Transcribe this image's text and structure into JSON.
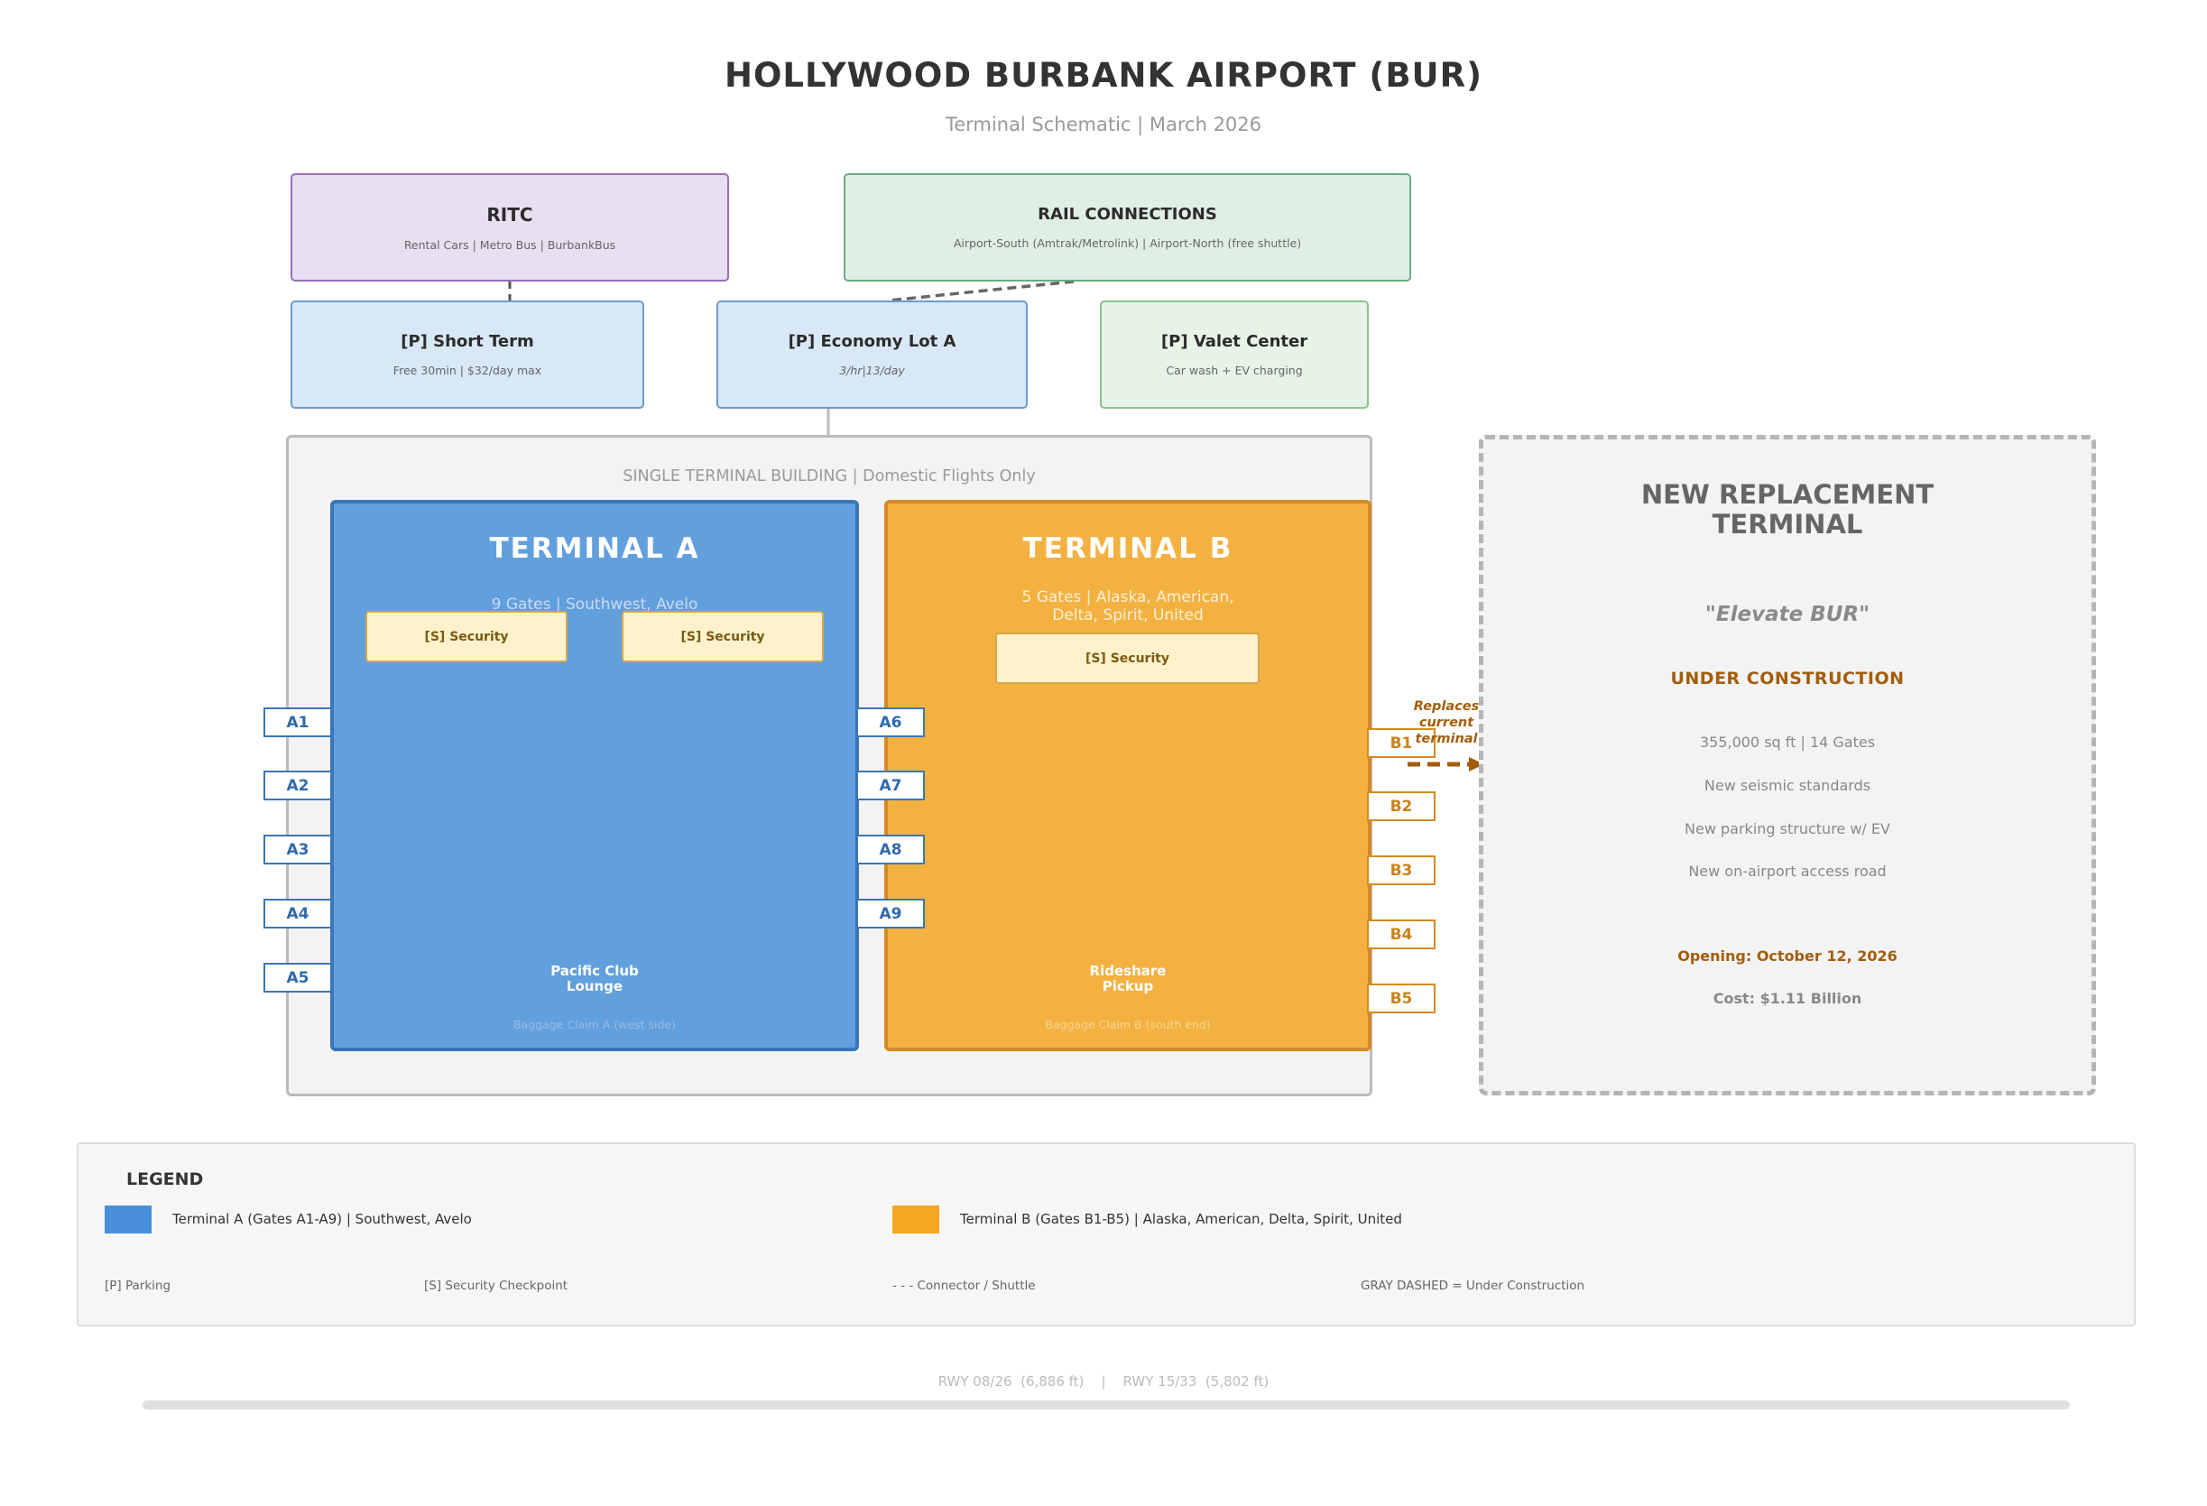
{
  "header": {
    "title": "HOLLYWOOD BURBANK AIRPORT  (BUR)",
    "subtitle": "Terminal Schematic  |  March 2026"
  },
  "top_boxes": {
    "ritc": {
      "title": "RITC",
      "subtitle": "Rental Cars  |  Metro Bus  |  BurbankBus"
    },
    "rail": {
      "title": "RAIL CONNECTIONS",
      "subtitle": "Airport-South (Amtrak/Metrolink)  |  Airport-North (free shuttle)"
    }
  },
  "parking": {
    "short_term": {
      "title": "[P]  Short Term",
      "subtitle": "Free 30min  |  $32/day max"
    },
    "economy": {
      "title": "[P]  Economy Lot A",
      "subtitle": "3/hr|13/day"
    },
    "valet": {
      "title": "[P]  Valet Center",
      "subtitle": "Car wash + EV charging"
    }
  },
  "building": {
    "label": "SINGLE TERMINAL BUILDING  |  Domestic Flights Only"
  },
  "terminal_a": {
    "title": "TERMINAL  A",
    "subtitle": "9 Gates  |  Southwest, Avelo",
    "security": [
      "[S] Security",
      "[S] Security"
    ],
    "amenity": "Pacific Club\nLounge",
    "baggage": "Baggage Claim A (west side)",
    "gates": [
      "A1",
      "A2",
      "A3",
      "A4",
      "A5",
      "A6",
      "A7",
      "A8",
      "A9"
    ]
  },
  "terminal_b": {
    "title": "TERMINAL  B",
    "subtitle": "5 Gates  |  Alaska, American,\nDelta, Spirit, United",
    "security": "[S] Security",
    "amenity": "Rideshare\nPickup",
    "baggage": "Baggage Claim B (south end)",
    "gates": [
      "B1",
      "B2",
      "B3",
      "B4",
      "B5"
    ]
  },
  "replaces_note": "Replaces\ncurrent\nterminal",
  "new_terminal": {
    "title": "NEW REPLACEMENT\nTERMINAL",
    "tagline": "\"Elevate BUR\"",
    "status": "UNDER CONSTRUCTION",
    "facts": [
      "355,000 sq ft  |  14 Gates",
      "New seismic standards",
      "New parking structure w/ EV",
      "New on-airport access road"
    ],
    "opening": "Opening: October 12, 2026",
    "cost": "Cost: $1.11 Billion"
  },
  "legend": {
    "title": "LEGEND",
    "terminal_a": "Terminal A  (Gates A1-A9)  |  Southwest, Avelo",
    "terminal_b": "Terminal B  (Gates B1-B5)  |  Alaska, American, Delta, Spirit, United",
    "notes": [
      "[P] Parking",
      "[S] Security Checkpoint",
      "- - - Connector / Shuttle",
      "GRAY DASHED = Under Construction"
    ]
  },
  "runway": {
    "label": "RWY 08/26  (6,886 ft)    |    RWY 15/33  (5,802 ft)"
  },
  "colors": {
    "terminal_a": "#629fdd",
    "terminal_a_legend": "#4a8fdb",
    "terminal_b": "#f3b142",
    "terminal_b_legend": "#f5a623",
    "construction": "#a35d0a"
  }
}
